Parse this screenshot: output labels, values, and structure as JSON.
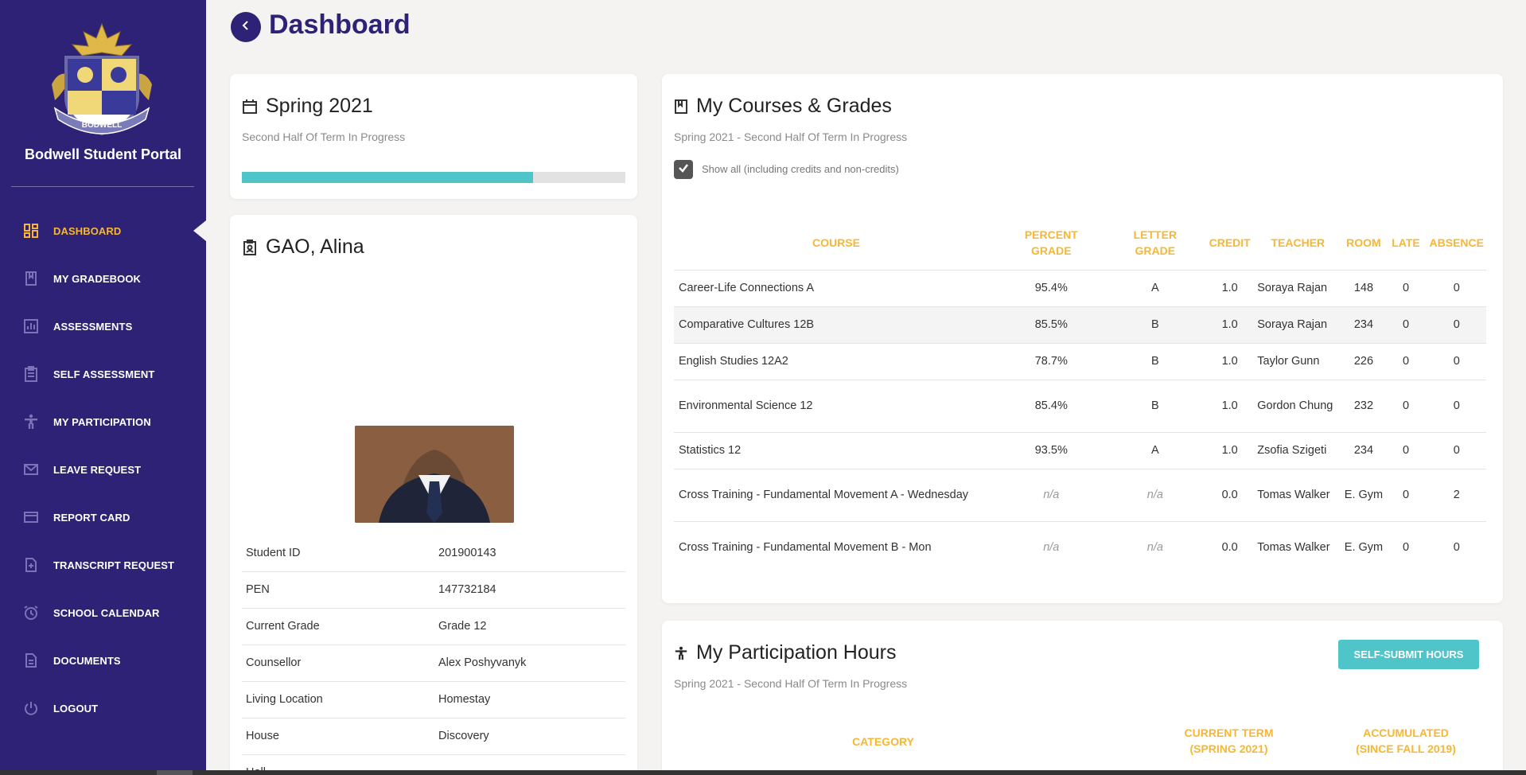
{
  "sidebar": {
    "portal_title": "Bodwell Student Portal",
    "logo_text": "BODWELL",
    "items": [
      {
        "label": "DASHBOARD",
        "icon": "dashboard-icon"
      },
      {
        "label": "MY GRADEBOOK",
        "icon": "book-icon"
      },
      {
        "label": "ASSESSMENTS",
        "icon": "chart-icon"
      },
      {
        "label": "SELF ASSESSMENT",
        "icon": "clipboard-icon"
      },
      {
        "label": "MY PARTICIPATION",
        "icon": "person-icon"
      },
      {
        "label": "LEAVE REQUEST",
        "icon": "mail-icon"
      },
      {
        "label": "REPORT CARD",
        "icon": "card-icon"
      },
      {
        "label": "TRANSCRIPT REQUEST",
        "icon": "file-plus-icon"
      },
      {
        "label": "SCHOOL CALENDAR",
        "icon": "alarm-icon"
      },
      {
        "label": "DOCUMENTS",
        "icon": "document-icon"
      },
      {
        "label": "LOGOUT",
        "icon": "power-icon"
      }
    ],
    "active_index": 0
  },
  "header": {
    "title": "Dashboard"
  },
  "term": {
    "title": "Spring 2021",
    "status": "Second Half Of Term In Progress",
    "progress": 0.76
  },
  "profile": {
    "name": "GAO, Alina",
    "fields": [
      {
        "label": "Student ID",
        "value": "201900143"
      },
      {
        "label": "PEN",
        "value": "147732184"
      },
      {
        "label": "Current Grade",
        "value": "Grade 12"
      },
      {
        "label": "Counsellor",
        "value": "Alex Poshyvanyk"
      },
      {
        "label": "Living Location",
        "value": "Homestay"
      },
      {
        "label": "House",
        "value": "Discovery"
      },
      {
        "label": "Hall",
        "value": ""
      }
    ]
  },
  "courses": {
    "title": "My Courses & Grades",
    "subtitle": "Spring 2021 - Second Half Of Term In Progress",
    "show_all_label": "Show all (including credits and non-credits)",
    "headers": {
      "course": "COURSE",
      "percent_1": "PERCENT",
      "percent_2": "GRADE",
      "letter_1": "LETTER",
      "letter_2": "GRADE",
      "credit": "CREDIT",
      "teacher": "TEACHER",
      "room": "ROOM",
      "late": "LATE",
      "absence": "ABSENCE"
    },
    "rows": [
      {
        "course": "Career-Life Connections A",
        "percent": "95.4%",
        "letter": "A",
        "credit": "1.0",
        "teacher": "Soraya Rajan",
        "room": "148",
        "late": "0",
        "absence": "0"
      },
      {
        "course": "Comparative Cultures 12B",
        "percent": "85.5%",
        "letter": "B",
        "credit": "1.0",
        "teacher": "Soraya Rajan",
        "room": "234",
        "late": "0",
        "absence": "0"
      },
      {
        "course": "English Studies 12A2",
        "percent": "78.7%",
        "letter": "B",
        "credit": "1.0",
        "teacher": "Taylor Gunn",
        "room": "226",
        "late": "0",
        "absence": "0"
      },
      {
        "course": "Environmental Science 12",
        "percent": "85.4%",
        "letter": "B",
        "credit": "1.0",
        "teacher": "Gordon Chung",
        "room": "232",
        "late": "0",
        "absence": "0"
      },
      {
        "course": "Statistics 12",
        "percent": "93.5%",
        "letter": "A",
        "credit": "1.0",
        "teacher": "Zsofia Szigeti",
        "room": "234",
        "late": "0",
        "absence": "0"
      },
      {
        "course": "Cross Training - Fundamental Movement A - Wednesday",
        "percent": "n/a",
        "letter": "n/a",
        "credit": "0.0",
        "teacher": "Tomas Walker",
        "room": "E. Gym",
        "late": "0",
        "absence": "2"
      },
      {
        "course": "Cross Training - Fundamental Movement B - Mon",
        "percent": "n/a",
        "letter": "n/a",
        "credit": "0.0",
        "teacher": "Tomas Walker",
        "room": "E. Gym",
        "late": "0",
        "absence": "0"
      }
    ]
  },
  "participation": {
    "title": "My Participation Hours",
    "subtitle": "Spring 2021 - Second Half Of Term In Progress",
    "button_label": "SELF-SUBMIT HOURS",
    "col_category": "CATEGORY",
    "col_current_1": "CURRENT TERM",
    "col_current_2": "(SPRING 2021)",
    "col_accum_1": "ACCUMULATED",
    "col_accum_2": "(SINCE FALL 2019)"
  },
  "colors": {
    "sidebar": "#2e2277",
    "accent": "#f7b733",
    "teal": "#4fc5c9"
  }
}
